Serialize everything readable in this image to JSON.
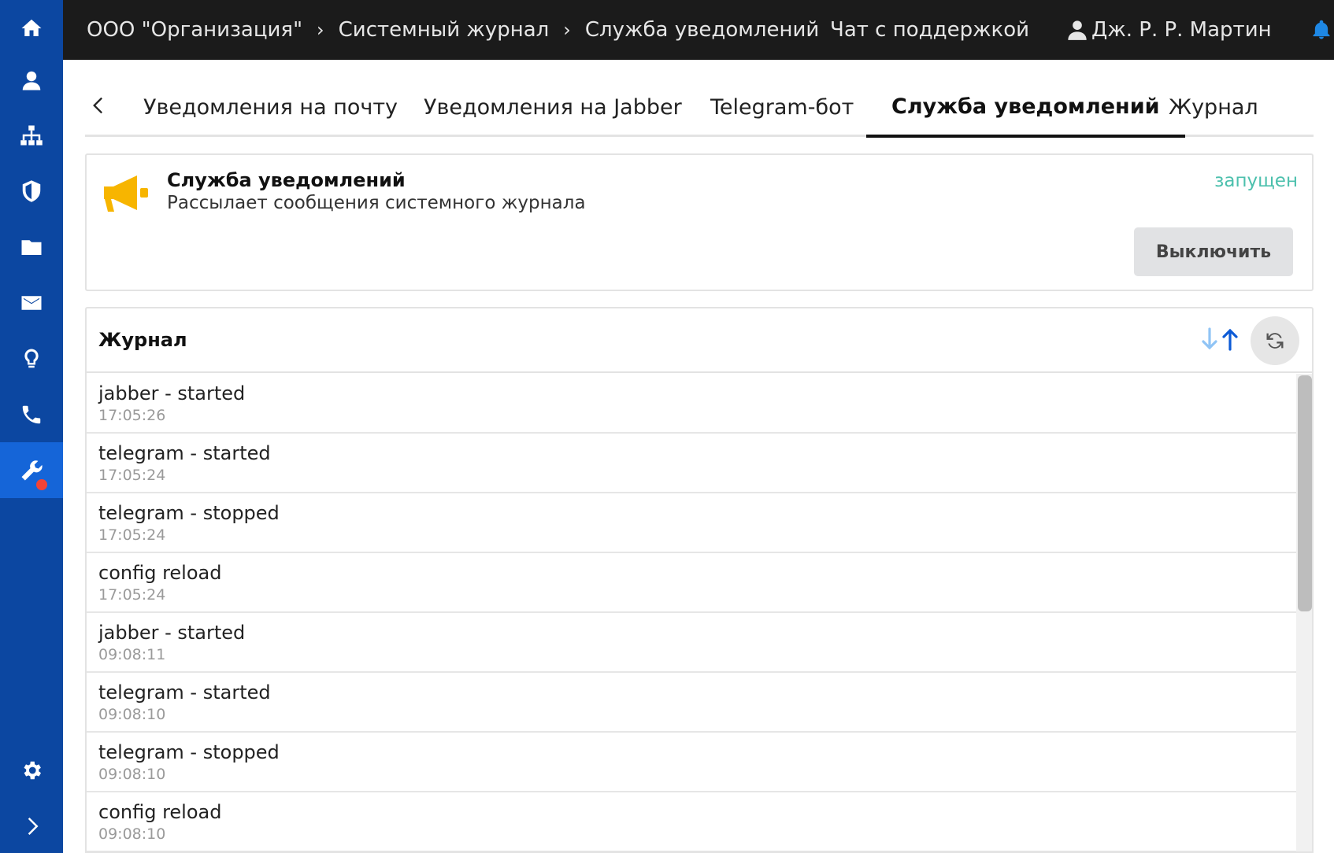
{
  "sidebar": {
    "items": [
      {
        "icon": "home-icon"
      },
      {
        "icon": "user-icon"
      },
      {
        "icon": "sitemap-icon"
      },
      {
        "icon": "shield-icon"
      },
      {
        "icon": "folder-icon"
      },
      {
        "icon": "mail-icon"
      },
      {
        "icon": "lightbulb-icon"
      },
      {
        "icon": "phone-icon"
      },
      {
        "icon": "wrench-icon",
        "active": true,
        "badge": true
      },
      {
        "icon": "gear-icon"
      },
      {
        "icon": "chevron-right-icon"
      }
    ],
    "colors": {
      "background": "#0c47a1",
      "active": "#1565d8",
      "badge": "#f44336"
    }
  },
  "topbar": {
    "breadcrumb": [
      "ООО \"Организация\"",
      "Системный журнал",
      "Служба уведомлений"
    ],
    "separator": "›",
    "support_chat": "Чат с поддержкой",
    "user_name": "Дж. Р. Р. Мартин"
  },
  "tabs": [
    {
      "label": "Уведомления на почту",
      "active": false
    },
    {
      "label": "Уведомления на Jabber",
      "active": false
    },
    {
      "label": "Telegram-бот",
      "active": false
    },
    {
      "label": "Служба уведомлений",
      "active": true
    },
    {
      "label": "Журнал",
      "active": false
    }
  ],
  "service": {
    "icon": "megaphone-icon",
    "title": "Служба уведомлений",
    "description": "Рассылает сообщения системного журнала",
    "status": "запущен",
    "status_color": "#4cc0ad",
    "button_label": "Выключить"
  },
  "log": {
    "title": "Журнал",
    "entries": [
      {
        "message": "jabber - started",
        "time": "17:05:26"
      },
      {
        "message": "telegram - started",
        "time": "17:05:24"
      },
      {
        "message": "telegram - stopped",
        "time": "17:05:24"
      },
      {
        "message": "config reload",
        "time": "17:05:24"
      },
      {
        "message": "jabber - started",
        "time": "09:08:11"
      },
      {
        "message": "telegram - started",
        "time": "09:08:10"
      },
      {
        "message": "telegram - stopped",
        "time": "09:08:10"
      },
      {
        "message": "config reload",
        "time": "09:08:10"
      }
    ]
  }
}
